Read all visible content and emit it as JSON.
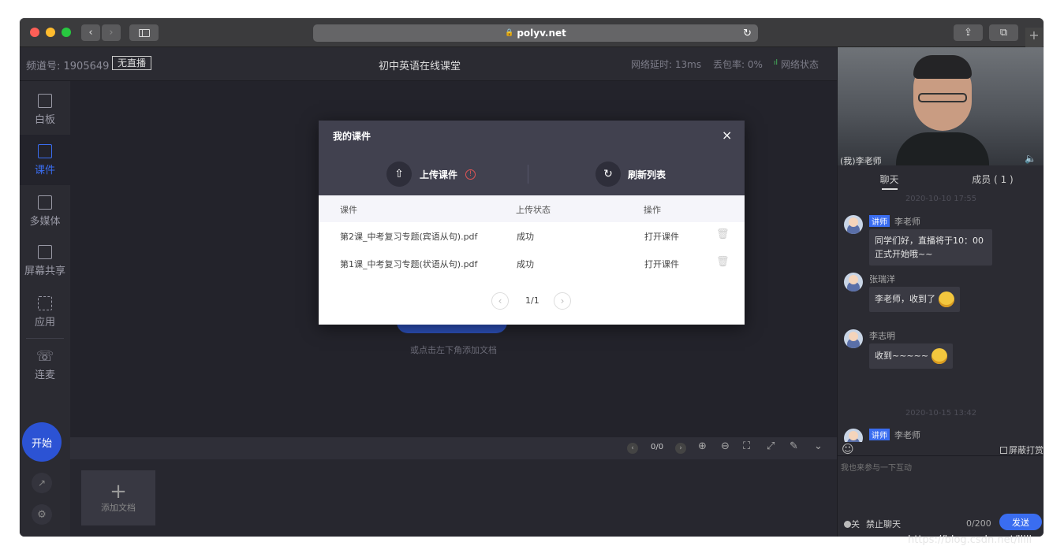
{
  "browser": {
    "url": "polyv.net",
    "new_tab": "+"
  },
  "topbar": {
    "channel": "频道号: 1905649",
    "live_status": "无直播",
    "title": "初中英语在线课堂",
    "latency": "网络延时: 13ms",
    "packet_loss": "丢包率: 0%",
    "network_status": "网络状态"
  },
  "sidebar": {
    "items": [
      {
        "label": "白板",
        "icon": "whiteboard-icon"
      },
      {
        "label": "课件",
        "icon": "courseware-icon"
      },
      {
        "label": "多媒体",
        "icon": "media-icon"
      },
      {
        "label": "屏幕共享",
        "icon": "screen-share-icon"
      },
      {
        "label": "应用",
        "icon": "apps-icon"
      },
      {
        "label": "连麦",
        "icon": "phone-icon"
      }
    ],
    "start_label": "开始"
  },
  "stage": {
    "hint": "或点击左下角添加文档"
  },
  "toolbar": {
    "page": "0/0"
  },
  "thumbs": {
    "add_label": "添加文档"
  },
  "modal": {
    "title": "我的课件",
    "upload_label": "上传课件",
    "refresh_label": "刷新列表",
    "columns": [
      "课件",
      "上传状态",
      "操作"
    ],
    "rows": [
      {
        "name": "第2课_中考复习专题(宾语从句).pdf",
        "status": "成功",
        "action": "打开课件"
      },
      {
        "name": "第1课_中考复习专题(状语从句).pdf",
        "status": "成功",
        "action": "打开课件"
      }
    ],
    "pagination": "1/1"
  },
  "right": {
    "video_label": "(我)李老师",
    "tabs": [
      "聊天",
      "成员 ( 1 )"
    ],
    "timestamps": [
      "2020-10-10 17:55",
      "2020-10-15 13:42"
    ],
    "teacher_badge": "讲师",
    "messages": [
      {
        "name": "李老师",
        "text": "同学们好，直播将于10：00正式开始哦~~"
      },
      {
        "name": "张瑞洋",
        "text": "李老师，收到了"
      },
      {
        "name": "李志明",
        "text": "收到~~~~~"
      },
      {
        "name": "李老师",
        "text": ""
      }
    ],
    "block_reward": "屏蔽打赏",
    "input_placeholder": "我也来参与一下互动",
    "toggle_label": "关",
    "mute_label": "禁止聊天",
    "char_count": "0/200",
    "send_label": "发送"
  },
  "watermark": "https://blog.csdn.net/lllll",
  "colors": {
    "accent": "#3a6df0",
    "warning": "#e05555"
  }
}
